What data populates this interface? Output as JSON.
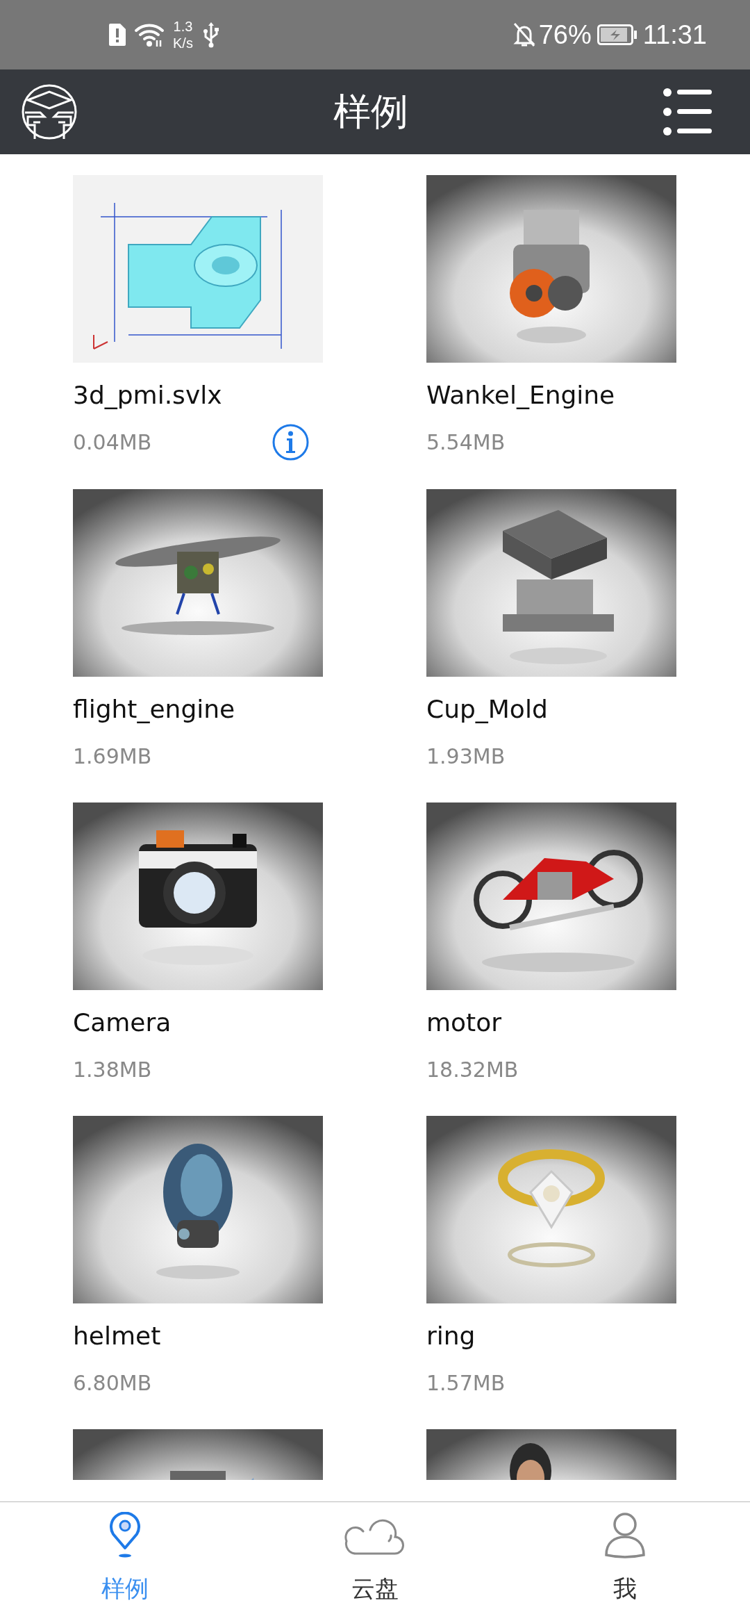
{
  "status_bar": {
    "speed_value": "1.3",
    "speed_unit": "K/s",
    "battery": "76%",
    "time": "11:31"
  },
  "header": {
    "title": "样例"
  },
  "samples": [
    {
      "kind": "card",
      "name": "3d_pmi.svlx",
      "size": "0.04MB",
      "info": true
    },
    {
      "kind": "card",
      "name": "Wankel_Engine",
      "size": "5.54MB",
      "info": false
    },
    {
      "kind": "card",
      "name": "flight_engine",
      "size": "1.69MB",
      "info": false
    },
    {
      "kind": "card",
      "name": "Cup_Mold",
      "size": "1.93MB",
      "info": false
    },
    {
      "kind": "card",
      "name": "Camera",
      "size": "1.38MB",
      "info": false
    },
    {
      "kind": "card",
      "name": "motor",
      "size": "18.32MB",
      "info": false
    },
    {
      "kind": "card",
      "name": "helmet",
      "size": "6.80MB",
      "info": false
    },
    {
      "kind": "card",
      "name": "ring",
      "size": "1.57MB",
      "info": false
    },
    {
      "kind": "picture"
    },
    {
      "kind": "picture"
    }
  ],
  "bottom_nav": [
    {
      "label": "样例",
      "selected": true
    },
    {
      "label": "云盘",
      "selected": false
    },
    {
      "label": "我",
      "selected": false
    }
  ]
}
